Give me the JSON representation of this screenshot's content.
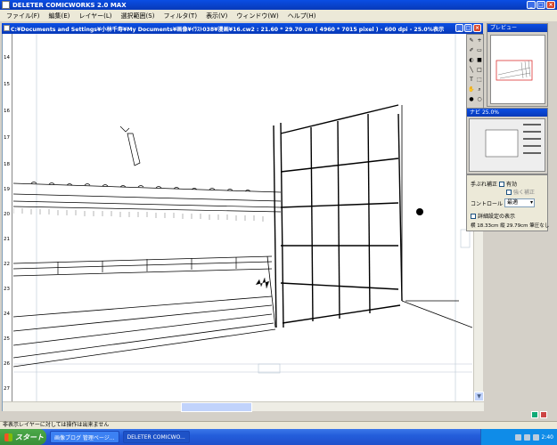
{
  "app": {
    "title": "DELETER COMICWORKS  2.0 MAX",
    "menu": [
      "ファイル(F)",
      "編集(E)",
      "レイヤー(L)",
      "選択範囲(S)",
      "フィルタ(T)",
      "表示(V)",
      "ウィンドウ(W)",
      "ヘルプ(H)"
    ]
  },
  "document": {
    "title": "C:¥Documents and Settings¥小林千寿¥My Documents¥画像¥ｲﾗｽﾄ038¥漫画¥16.cw2 : 21.60 * 29.70 cm ( 4960 * 7015 pixel ) - 600 dpi - 25.0%表示",
    "ruler_marks": [
      "14",
      "15",
      "16",
      "17",
      "18",
      "19",
      "20",
      "21",
      "22",
      "23",
      "24",
      "25",
      "26",
      "27"
    ]
  },
  "panels": {
    "preview_title": "プレビュー",
    "nav_title": "ナビ",
    "nav_zoom": "25.0%",
    "hand": {
      "label": "手ぶれ補正",
      "enabled_label": "有効",
      "strong_label": "強く補正",
      "control_label": "コントロール",
      "control_value": "最適",
      "detail_label": "詳細設定の表示",
      "info": "横 18.33cm 縦 29.79cm  筆圧なし"
    }
  },
  "status": {
    "text": "非表示レイヤーに対しては操作は出来ません"
  },
  "taskbar": {
    "start": "スタート",
    "tasks": [
      "画像ブログ 管理ページ...",
      "DELETER COMICWO..."
    ],
    "clock": "2:40"
  }
}
